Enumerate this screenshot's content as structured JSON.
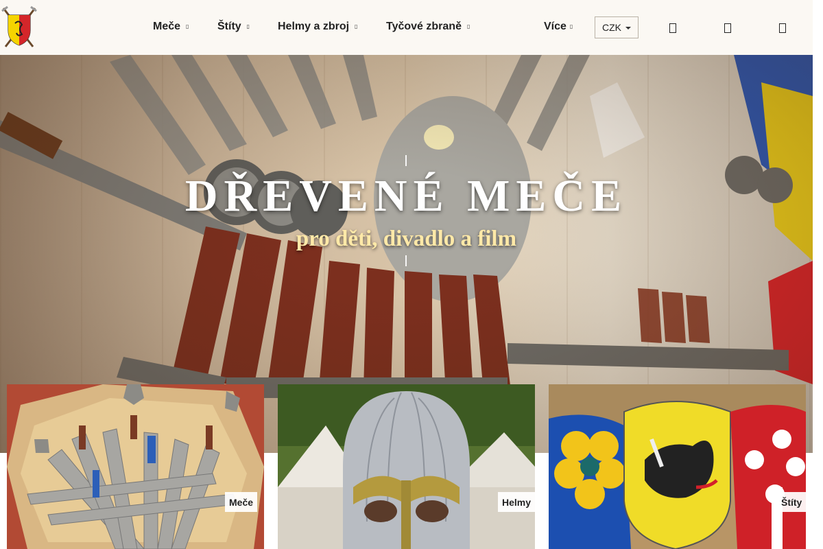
{
  "header": {
    "nav": [
      {
        "label": "Meče",
        "caret": "▯"
      },
      {
        "label": "Štíty",
        "caret": "▯"
      },
      {
        "label": "Helmy a zbroj",
        "caret": "▯"
      },
      {
        "label": "Tyčové zbraně",
        "caret": "▯"
      }
    ],
    "more": {
      "label": "Více",
      "caret": "▯"
    },
    "currency": {
      "selected": "CZK"
    },
    "icons": [
      "search-icon",
      "user-icon",
      "cart-icon"
    ]
  },
  "hero": {
    "title": "DŘEVENÉ MEČE",
    "subtitle": "pro děti, divadlo a film"
  },
  "categories": [
    {
      "label": "Meče"
    },
    {
      "label": "Helmy"
    },
    {
      "label": "Štíty"
    }
  ],
  "colors": {
    "header_bg": "#fbf8f3",
    "hero_subtitle": "#ffe9a8",
    "text": "#222222"
  }
}
